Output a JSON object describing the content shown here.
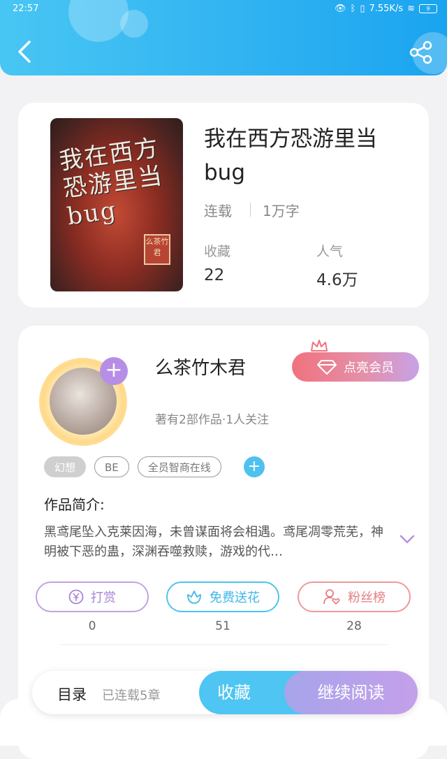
{
  "status_bar": {
    "time": "22:57",
    "network": "7.55K/s",
    "battery": "9"
  },
  "header": {
    "back_icon": "chevron-left-icon",
    "share_icon": "share-icon"
  },
  "book": {
    "cover_text": "我在西方恐游里当bug",
    "cover_seal": "么茶竹君",
    "title": "我在西方恐游里当bug",
    "status": "连载",
    "word_count": "1万字",
    "favorites_label": "收藏",
    "favorites_value": "22",
    "popularity_label": "人气",
    "popularity_value": "4.6万"
  },
  "author": {
    "name": "么茶竹木君",
    "stats": "著有2部作品·1人关注",
    "vip_label": "点亮会员",
    "tags": [
      "幻想",
      "BE",
      "全员智商在线"
    ],
    "intro_label": "作品简介:",
    "intro_text": "黑鸢尾坠入克莱因海，未曾谋面将会相遇。鸢尾凋零荒芜，神明被下恶的蛊，深渊吞噬救赎，游戏的代…"
  },
  "actions": [
    {
      "label": "打赏",
      "count": "0"
    },
    {
      "label": "免费送花",
      "count": "51"
    },
    {
      "label": "粉丝榜",
      "count": "28"
    }
  ],
  "bottom": {
    "toc_label": "目录",
    "toc_sub": "已连载5章",
    "fav_label": "收藏",
    "read_label": "继续阅读"
  },
  "colors": {
    "header": "#31b3f2",
    "accent_blue": "#4ec5f2",
    "accent_purple": "#c4a0ea",
    "vip_pink": "#f0727e"
  }
}
